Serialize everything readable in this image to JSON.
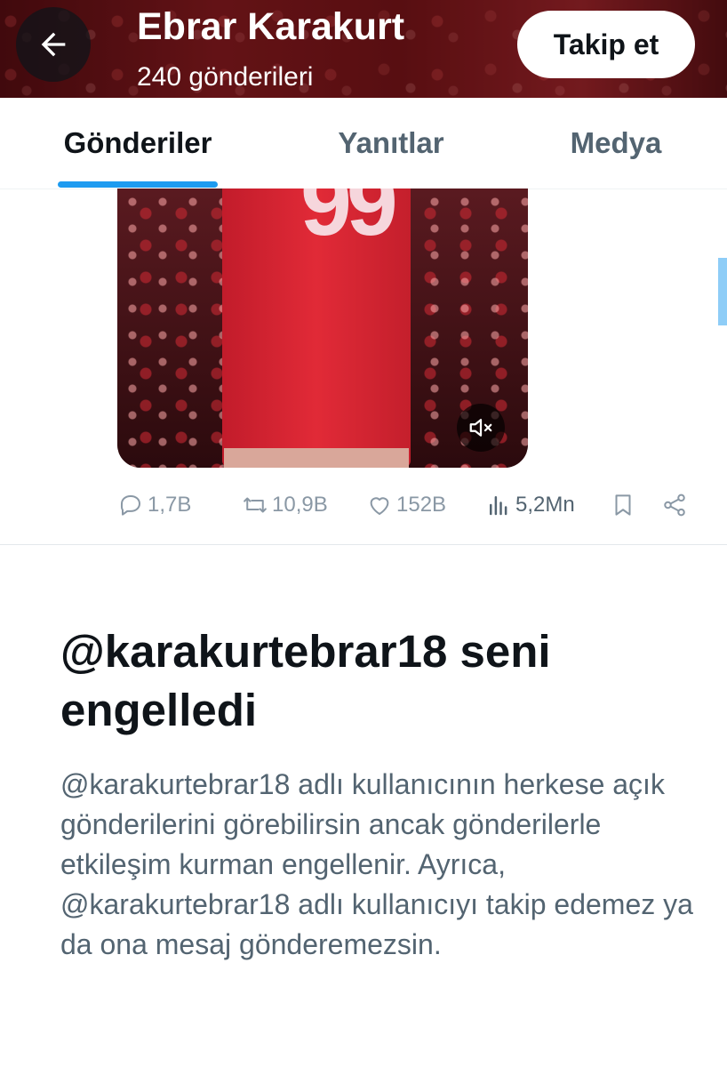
{
  "header": {
    "back_icon": "arrow-left-icon",
    "name": "Ebrar Karakurt",
    "post_count": "240 gönderileri",
    "follow_label": "Takip et"
  },
  "tabs": [
    {
      "label": "Gönderiler",
      "active": true
    },
    {
      "label": "Yanıtlar",
      "active": false
    },
    {
      "label": "Medya",
      "active": false
    }
  ],
  "media": {
    "jersey_number": "99",
    "mute_icon": "volume-muted-icon"
  },
  "actions": {
    "replies": "1,7B",
    "reposts": "10,9B",
    "likes": "152B",
    "views": "5,2Mn",
    "bookmark_icon": "bookmark-icon",
    "share_icon": "share-icon"
  },
  "blocked": {
    "title": "@karakurtebrar18 seni engelledi",
    "description": "@karakurtebrar18 adlı kullanıcının herkese açık gönderilerini görebilirsin ancak gönderilerle etkileşim kurman engellenir. Ayrıca, @karakurtebrar18 adlı kullanıcıyı takip edemez ya da ona mesaj gönderemezsin."
  },
  "colors": {
    "accent": "#1d9bf0",
    "text_primary": "#0f1419",
    "text_secondary": "#536471",
    "header_bg": "#8a1a1f"
  }
}
